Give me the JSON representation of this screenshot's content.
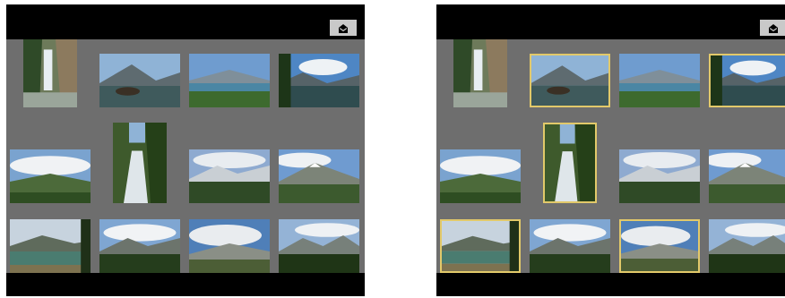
{
  "accent_color": "#e2c96a",
  "screens": [
    {
      "menu_icon": "envelope-icon",
      "thumbnails": [
        {
          "scene": "waterfall-canyon",
          "orientation": "portrait",
          "selected": false
        },
        {
          "scene": "lake-peak-rock",
          "orientation": "landscape",
          "selected": false
        },
        {
          "scene": "lake-forest",
          "orientation": "landscape",
          "selected": false
        },
        {
          "scene": "lake-clouds",
          "orientation": "landscape",
          "selected": false
        },
        {
          "scene": "valley-clouds",
          "orientation": "landscape",
          "selected": false
        },
        {
          "scene": "waterfall-forest",
          "orientation": "portrait",
          "selected": false
        },
        {
          "scene": "snow-ridge-forest",
          "orientation": "landscape",
          "selected": false
        },
        {
          "scene": "snow-peak-valley",
          "orientation": "landscape",
          "selected": false
        },
        {
          "scene": "lake-shore-cloudy",
          "orientation": "landscape",
          "selected": false
        },
        {
          "scene": "cloud-peaks-trees",
          "orientation": "landscape",
          "selected": false
        },
        {
          "scene": "glacier-valley",
          "orientation": "landscape",
          "selected": false
        },
        {
          "scene": "peaks-evergreens",
          "orientation": "landscape",
          "selected": false
        }
      ]
    },
    {
      "menu_icon": "envelope-icon",
      "thumbnails": [
        {
          "scene": "waterfall-canyon",
          "orientation": "portrait",
          "selected": false
        },
        {
          "scene": "lake-peak-rock",
          "orientation": "landscape",
          "selected": true
        },
        {
          "scene": "lake-forest",
          "orientation": "landscape",
          "selected": false
        },
        {
          "scene": "lake-clouds",
          "orientation": "landscape",
          "selected": true
        },
        {
          "scene": "valley-clouds",
          "orientation": "landscape",
          "selected": false
        },
        {
          "scene": "waterfall-forest",
          "orientation": "portrait",
          "selected": true
        },
        {
          "scene": "snow-ridge-forest",
          "orientation": "landscape",
          "selected": false
        },
        {
          "scene": "snow-peak-valley",
          "orientation": "landscape",
          "selected": false
        },
        {
          "scene": "lake-shore-cloudy",
          "orientation": "landscape",
          "selected": true
        },
        {
          "scene": "cloud-peaks-trees",
          "orientation": "landscape",
          "selected": false
        },
        {
          "scene": "glacier-valley",
          "orientation": "landscape",
          "selected": true
        },
        {
          "scene": "peaks-evergreens",
          "orientation": "landscape",
          "selected": false
        }
      ]
    }
  ]
}
